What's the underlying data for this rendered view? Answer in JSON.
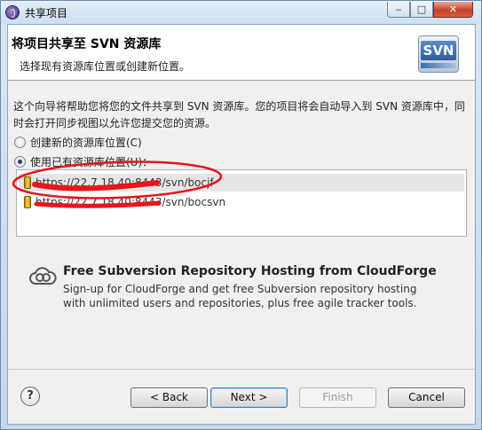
{
  "window": {
    "title": "共享项目"
  },
  "header": {
    "title": "将项目共享至 SVN 资源库",
    "description": "选择现有资源库位置或创建新位置。",
    "logo_text": "SVN"
  },
  "instructions": "这个向导将帮助您将您的文件共享到 SVN 资源库。您的项目将会自动导入到 SVN 资源库中，同时会打开同步视图以允许您提交您的资源。",
  "options": {
    "create_new": "创建新的资源库位置(C)",
    "use_existing": "使用已有资源库位置(U)："
  },
  "repositories": [
    {
      "url": "https://22.7.18.40:8443/svn/bocjf"
    },
    {
      "url": "https://22.7.18.40:8443/svn/bocsvn"
    }
  ],
  "promo": {
    "title": "Free Subversion Repository Hosting from CloudForge",
    "line1": "Sign-up for CloudForge and get free Subversion repository hosting",
    "line2": "with unlimited users and repositories, plus free agile tracker tools."
  },
  "buttons": {
    "help": "?",
    "back": "< Back",
    "next": "Next >",
    "finish": "Finish",
    "cancel": "Cancel"
  },
  "colors": {
    "scribble": "#e8151b",
    "accent": "#3c7fb1"
  }
}
